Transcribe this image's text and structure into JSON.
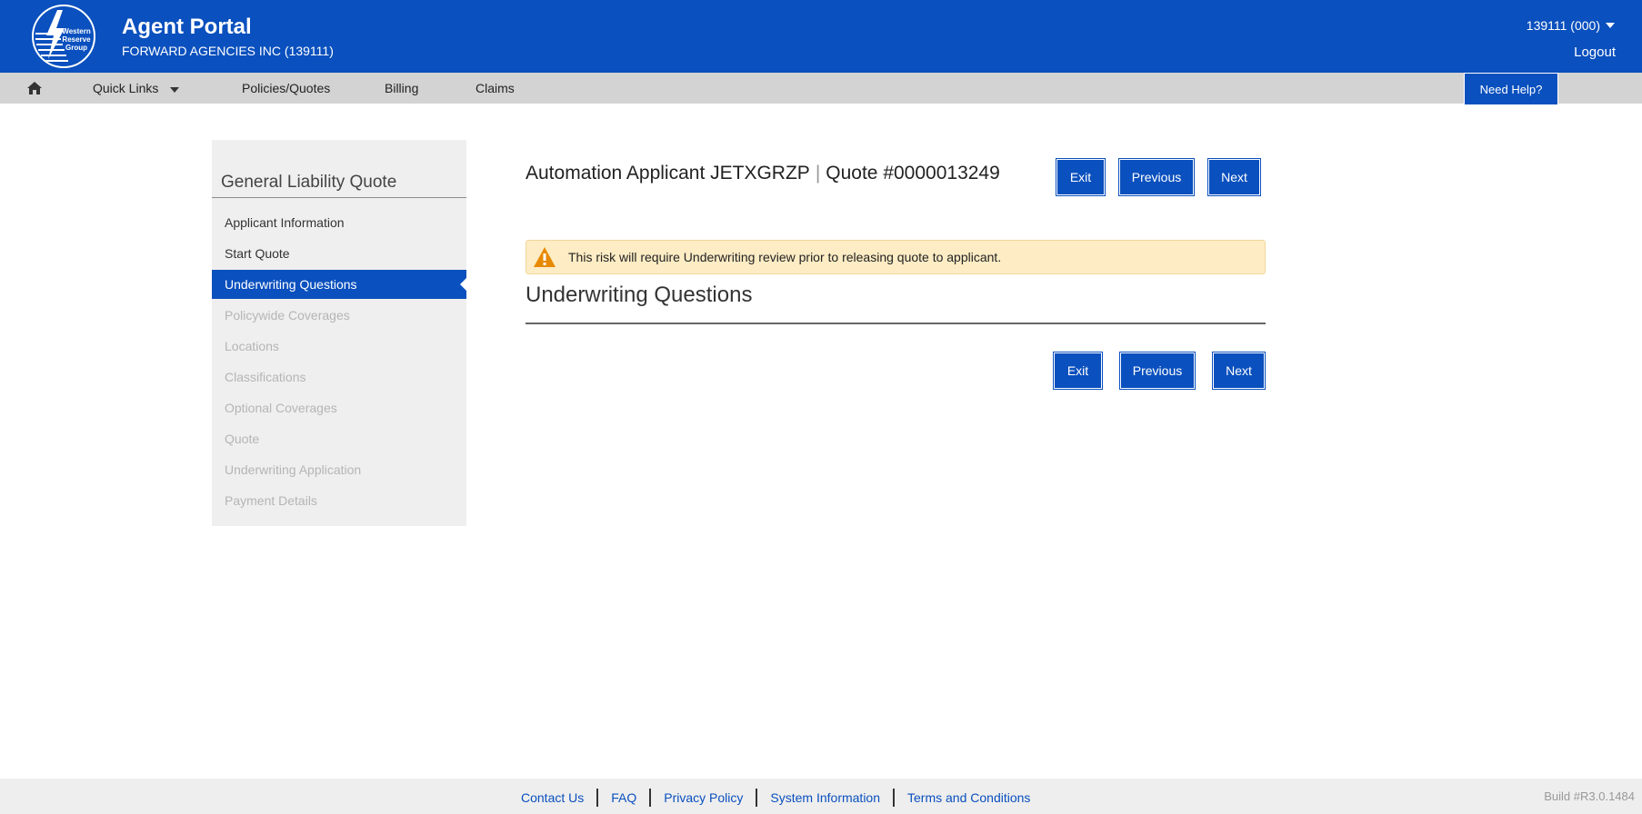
{
  "header": {
    "logo_text": "Western Reserve Group",
    "title": "Agent Portal",
    "subtitle": "FORWARD AGENCIES INC (139111)",
    "account": "139111 (000)",
    "logout": "Logout"
  },
  "nav": {
    "home_icon": "home-icon",
    "quick_links": "Quick Links",
    "policies": "Policies/Quotes",
    "billing": "Billing",
    "claims": "Claims",
    "need_help": "Need Help?"
  },
  "sidebar": {
    "title": "General Liability Quote",
    "items": [
      {
        "label": "Applicant Information",
        "state": "enabled"
      },
      {
        "label": "Start Quote",
        "state": "enabled"
      },
      {
        "label": "Underwriting Questions",
        "state": "active"
      },
      {
        "label": "Policywide Coverages",
        "state": "disabled"
      },
      {
        "label": "Locations",
        "state": "disabled"
      },
      {
        "label": "Classifications",
        "state": "disabled"
      },
      {
        "label": "Optional Coverages",
        "state": "disabled"
      },
      {
        "label": "Quote",
        "state": "disabled"
      },
      {
        "label": "Underwriting Application",
        "state": "disabled"
      },
      {
        "label": "Payment Details",
        "state": "disabled"
      }
    ]
  },
  "main": {
    "applicant": "Automation Applicant JETXGRZP",
    "separator": "|",
    "quote_number": "Quote #0000013249",
    "buttons": {
      "exit": "Exit",
      "previous": "Previous",
      "next": "Next"
    },
    "alert_text": "This risk will require Underwriting review prior to releasing quote to applicant.",
    "section_title": "Underwriting Questions"
  },
  "footer": {
    "links": [
      "Contact Us",
      "FAQ",
      "Privacy Policy",
      "System Information",
      "Terms and Conditions"
    ],
    "build": "Build #R3.0.1484"
  },
  "colors": {
    "brand_blue": "#0a50be",
    "nav_gray": "#d3d3d3",
    "alert_bg": "#fdecc4",
    "warning_orange": "#e88a00"
  }
}
